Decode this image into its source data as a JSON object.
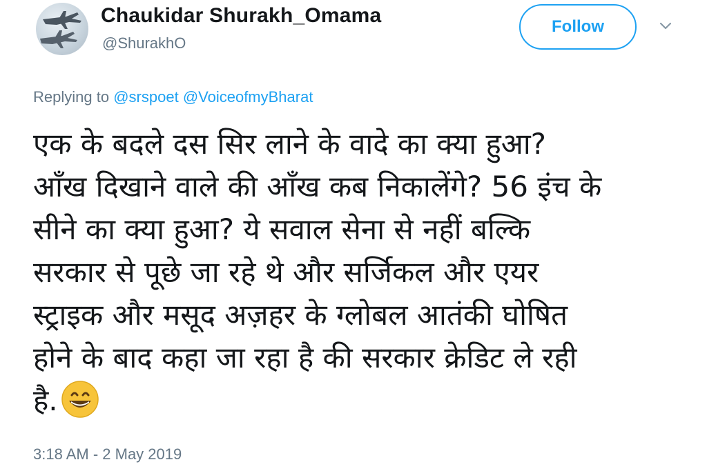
{
  "user": {
    "display_name": "Chaukidar Shurakh_Omama",
    "handle": "@ShurakhO",
    "avatar_icon": "fighter-jet-avatar"
  },
  "follow_label": "Follow",
  "replying": {
    "prefix": "Replying to",
    "mentions": [
      "@srspoet",
      "@VoiceofmyBharat"
    ]
  },
  "tweet": {
    "lines": [
      "एक के बदले दस सिर लाने के वादे का क्या हुआ?",
      "आँख दिखाने वाले की आँख कब निकालेंगे? 56 इंच के",
      "सीने का क्या हुआ? ये सवाल सेना से नहीं बल्कि",
      "सरकार से पूछे जा रहे थे और सर्जिकल और एयर",
      "स्ट्राइक और मसूद अज़हर के ग्लोबल आतंकी घोषित",
      "होने के बाद कहा जा रहा है की सरकार क्रेडिट ले रही",
      "है."
    ],
    "emoji_icon": "grinning-face-emoji"
  },
  "timestamp": "3:18 AM - 2 May 2019",
  "colors": {
    "accent": "#1da1f2",
    "muted": "#657786",
    "text": "#14171a"
  }
}
